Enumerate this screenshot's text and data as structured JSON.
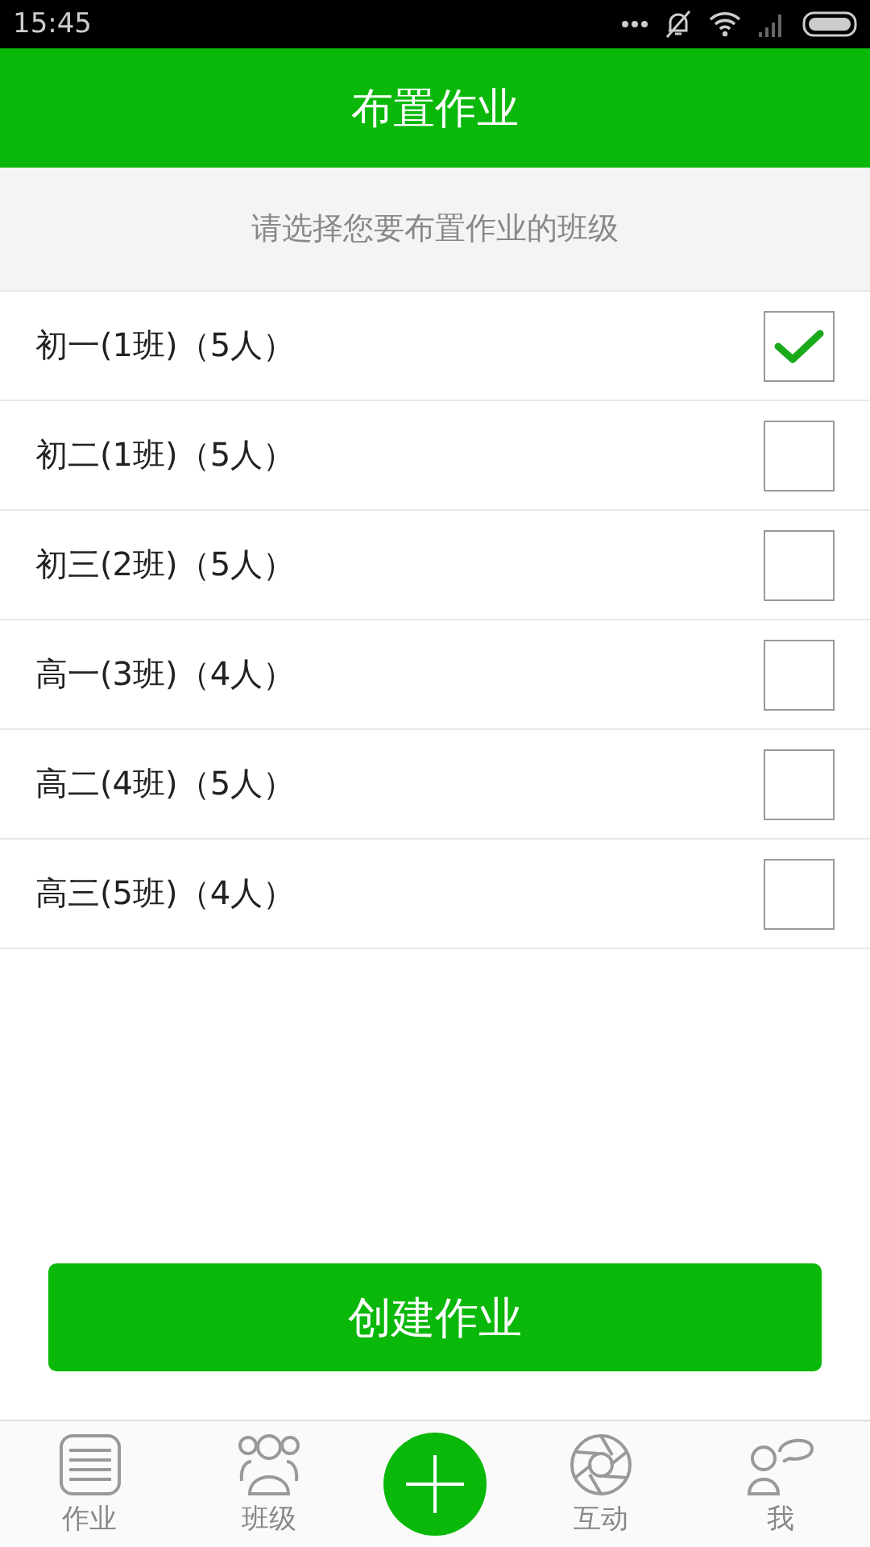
{
  "status_bar": {
    "time": "15:45"
  },
  "header": {
    "title": "布置作业"
  },
  "prompt": "请选择您要布置作业的班级",
  "classes": [
    {
      "name": "初一(1班)（5人）",
      "checked": true
    },
    {
      "name": "初二(1班)（5人）",
      "checked": false
    },
    {
      "name": "初三(2班)（5人）",
      "checked": false
    },
    {
      "name": "高一(3班)（4人）",
      "checked": false
    },
    {
      "name": "高二(4班)（5人）",
      "checked": false
    },
    {
      "name": "高三(5班)（4人）",
      "checked": false
    }
  ],
  "create_button": "创建作业",
  "tab_bar": [
    {
      "kind": "list",
      "label": "作业"
    },
    {
      "kind": "people",
      "label": "班级"
    },
    {
      "kind": "plus"
    },
    {
      "kind": "aperture",
      "label": "互动"
    },
    {
      "kind": "me",
      "label": "我"
    }
  ]
}
